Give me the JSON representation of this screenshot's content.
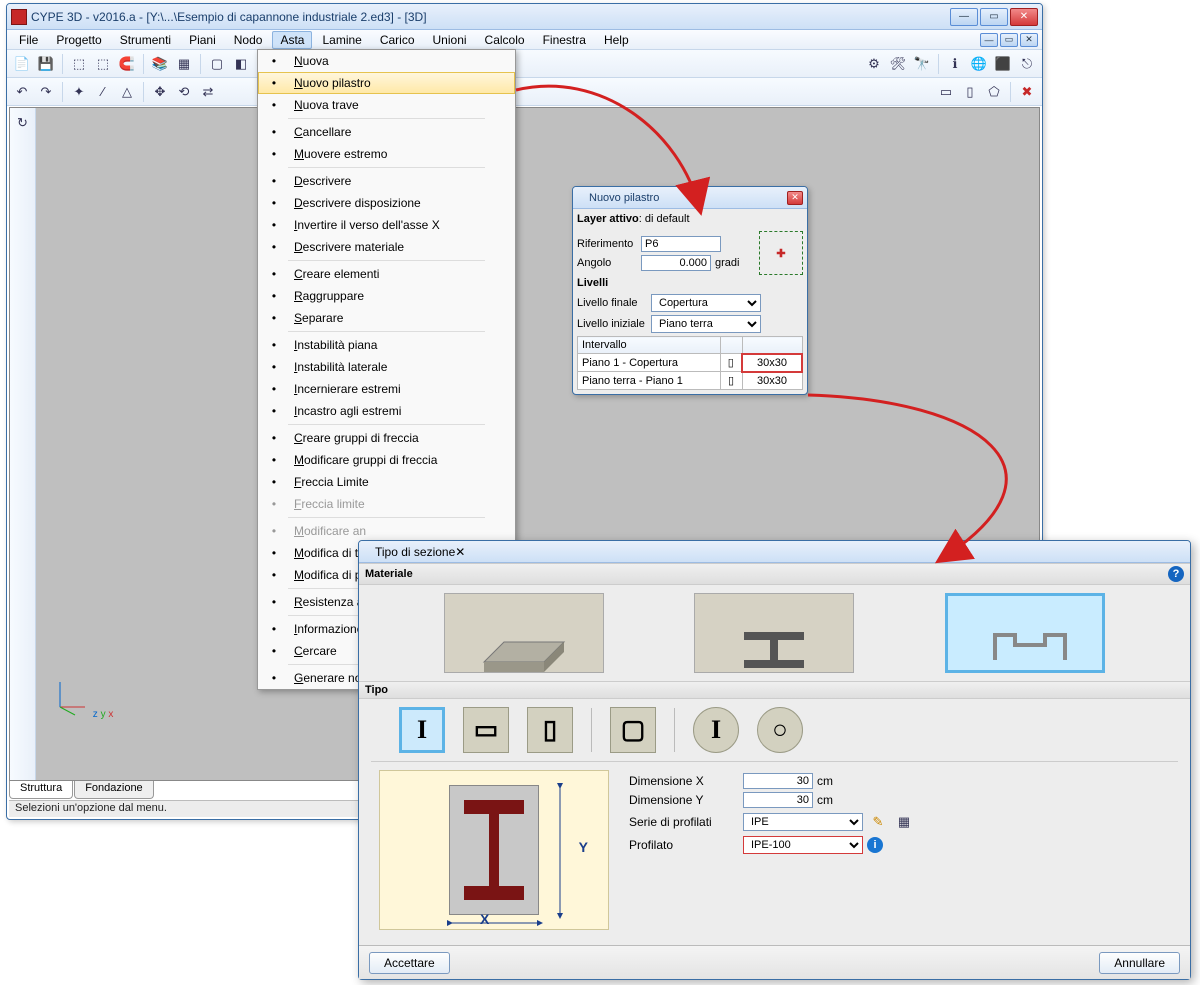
{
  "main": {
    "title": "CYPE 3D - v2016.a - [Y:\\...\\Esempio di capannone industriale 2.ed3] - [3D]",
    "menu": [
      "File",
      "Progetto",
      "Strumenti",
      "Piani",
      "Nodo",
      "Asta",
      "Lamine",
      "Carico",
      "Unioni",
      "Calcolo",
      "Finestra",
      "Help"
    ],
    "active_menu": "Asta",
    "tabs": [
      "Struttura",
      "Fondazione"
    ],
    "active_tab": "Struttura",
    "status": "Selezioni un'opzione dal menu."
  },
  "asta_menu": [
    {
      "label": "Nuova"
    },
    {
      "label": "Nuovo pilastro",
      "selected": true
    },
    {
      "label": "Nuova trave"
    },
    {
      "sep": true
    },
    {
      "label": "Cancellare"
    },
    {
      "label": "Muovere estremo"
    },
    {
      "sep": true
    },
    {
      "label": "Descrivere"
    },
    {
      "label": "Descrivere disposizione"
    },
    {
      "label": "Invertire il verso dell'asse X"
    },
    {
      "label": "Descrivere materiale"
    },
    {
      "sep": true
    },
    {
      "label": "Creare elementi"
    },
    {
      "label": "Raggruppare"
    },
    {
      "label": "Separare"
    },
    {
      "sep": true
    },
    {
      "label": "Instabilità piana"
    },
    {
      "label": "Instabilità laterale"
    },
    {
      "label": "Incernierare estremi"
    },
    {
      "label": "Incastro agli estremi"
    },
    {
      "sep": true
    },
    {
      "label": "Creare gruppi di freccia"
    },
    {
      "label": "Modificare gruppi di freccia"
    },
    {
      "label": "Freccia Limite"
    },
    {
      "label": "Freccia limite",
      "disabled": true
    },
    {
      "sep": true
    },
    {
      "label": "Modificare an",
      "disabled": true
    },
    {
      "label": "Modifica di tr"
    },
    {
      "label": "Modifica di p"
    },
    {
      "sep": true
    },
    {
      "label": "Resistenza al f"
    },
    {
      "sep": true
    },
    {
      "label": "Informazione"
    },
    {
      "label": "Cercare"
    },
    {
      "sep": true
    },
    {
      "label": "Generare nod"
    }
  ],
  "pilastro": {
    "title": "Nuovo pilastro",
    "layer_label": "Layer attivo",
    "layer_value": "di default",
    "rif_label": "Riferimento",
    "rif_value": "P6",
    "ang_label": "Angolo",
    "ang_value": "0.000",
    "ang_unit": "gradi",
    "livelli": "Livelli",
    "liv_fin_label": "Livello finale",
    "liv_fin_value": "Copertura",
    "liv_ini_label": "Livello iniziale",
    "liv_ini_value": "Piano terra",
    "col_int": "Intervallo",
    "rows": [
      {
        "int": "Piano 1 - Copertura",
        "dim": "30x30",
        "sel": true
      },
      {
        "int": "Piano terra - Piano 1",
        "dim": "30x30"
      }
    ]
  },
  "sezione": {
    "title": "Tipo di sezione",
    "sec_mat": "Materiale",
    "sec_tipo": "Tipo",
    "dimx_label": "Dimensione X",
    "dimx_value": "30",
    "dimx_unit": "cm",
    "dimy_label": "Dimensione Y",
    "dimy_value": "30",
    "dimy_unit": "cm",
    "serie_label": "Serie di profilati",
    "serie_value": "IPE",
    "prof_label": "Profilato",
    "prof_value": "IPE-100",
    "x_axis": "X",
    "y_axis": "Y",
    "ok": "Accettare",
    "cancel": "Annullare"
  }
}
